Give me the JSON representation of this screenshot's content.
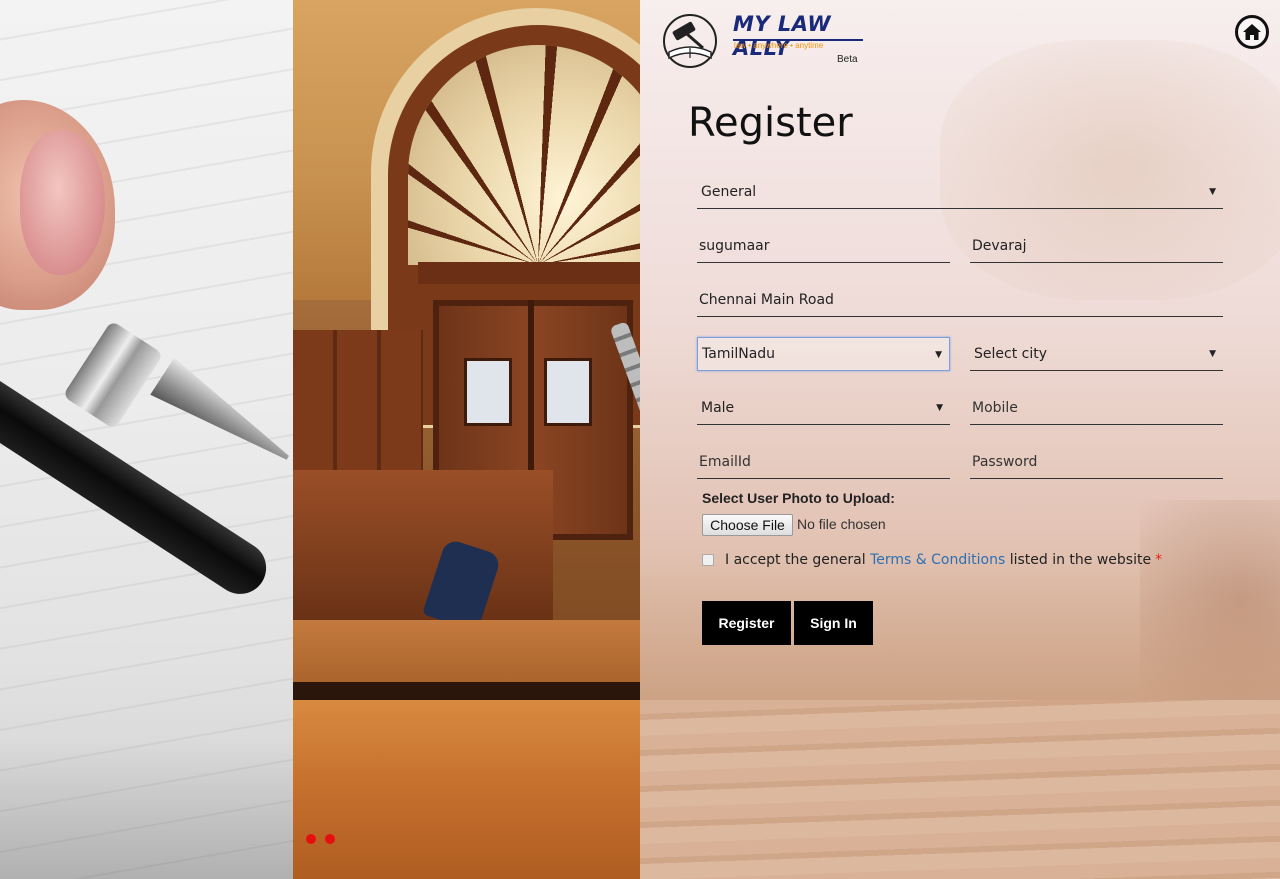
{
  "branding": {
    "brand_name": "MY LAW ALLY",
    "tagline": "law  •  anywhere  •  anytime",
    "beta_label": "Beta"
  },
  "page": {
    "title": "Register"
  },
  "form": {
    "user_type": {
      "selected": "General"
    },
    "first_name": {
      "value": "sugumaar"
    },
    "last_name": {
      "value": "Devaraj"
    },
    "address": {
      "value": "Chennai Main Road"
    },
    "state": {
      "selected": "TamilNadu"
    },
    "city": {
      "selected": "Select city"
    },
    "gender": {
      "selected": "Male"
    },
    "mobile": {
      "placeholder": "Mobile"
    },
    "email": {
      "placeholder": "EmailId"
    },
    "password": {
      "placeholder": "Password"
    },
    "photo_upload_label": "Select User Photo to Upload:",
    "file_button_label": "Choose File",
    "file_status": "No file chosen",
    "terms": {
      "prefix": "I accept the general",
      "link_text": "Terms & Conditions",
      "suffix": "listed in the website",
      "required_mark": "*"
    },
    "register_button": "Register",
    "signin_button": "Sign In"
  },
  "icons": {
    "home": "home-icon",
    "dropdown": "caret-down-icon",
    "logo_emblem": "gavel-book-emblem"
  },
  "colors": {
    "brand_blue": "#1a2a7a",
    "brand_orange": "#f5930a",
    "link_blue": "#2d6fb2",
    "button_black": "#000000",
    "slider_dot_red": "#e60f0f",
    "required_red": "#e2231a"
  },
  "carousel": {
    "dot_count": 2
  }
}
